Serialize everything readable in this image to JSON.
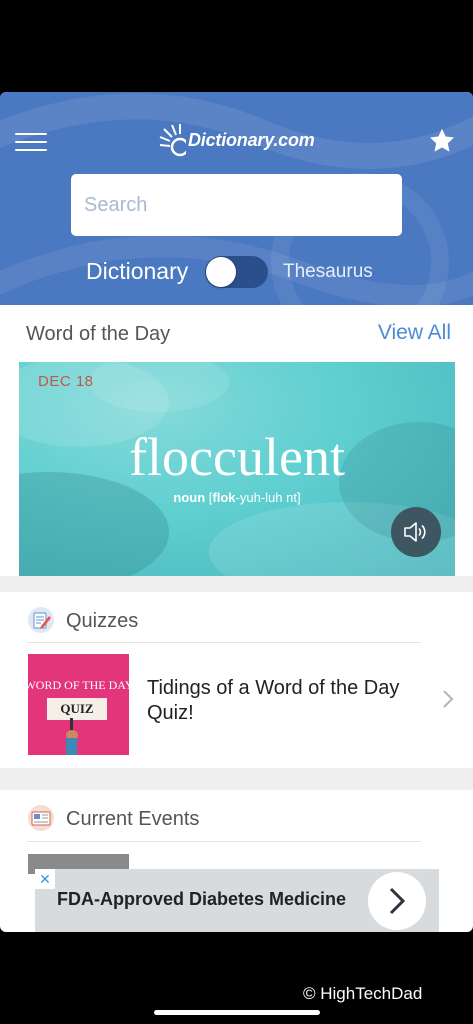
{
  "header": {
    "logo_text": "Dictionary.com",
    "menu_icon": "hamburger-icon",
    "favorites_icon": "star-icon",
    "bg_color": "#4a78c1"
  },
  "search": {
    "placeholder": "Search",
    "value": ""
  },
  "mode_toggle": {
    "left_label": "Dictionary",
    "right_label": "Thesaurus",
    "selected": "Dictionary"
  },
  "word_of_the_day": {
    "section_title": "Word of the Day",
    "view_all_label": "View All",
    "date": "DEC 18",
    "word": "flocculent",
    "part_of_speech": "noun",
    "pron_open": "[",
    "pron_stress": "flok",
    "pron_rest": "-yuh-luh nt]",
    "audio_icon": "speaker-icon"
  },
  "quizzes": {
    "section_title": "Quizzes",
    "icon": "quiz-icon",
    "items": [
      {
        "thumb_top_text": "WORD OF THE DAY",
        "thumb_sign_text": "QUIZ",
        "title": "Tidings of a Word of the Day Quiz!"
      }
    ]
  },
  "current_events": {
    "section_title": "Current Events",
    "icon": "news-icon"
  },
  "ad": {
    "close_label": "✕",
    "text": "FDA-Approved Diabetes Medicine"
  },
  "watermark": "© HighTechDad",
  "colors": {
    "accent": "#4a8ad6",
    "wotd_bg": "#5fcfd0",
    "quiz_pink": "#e2357b"
  }
}
